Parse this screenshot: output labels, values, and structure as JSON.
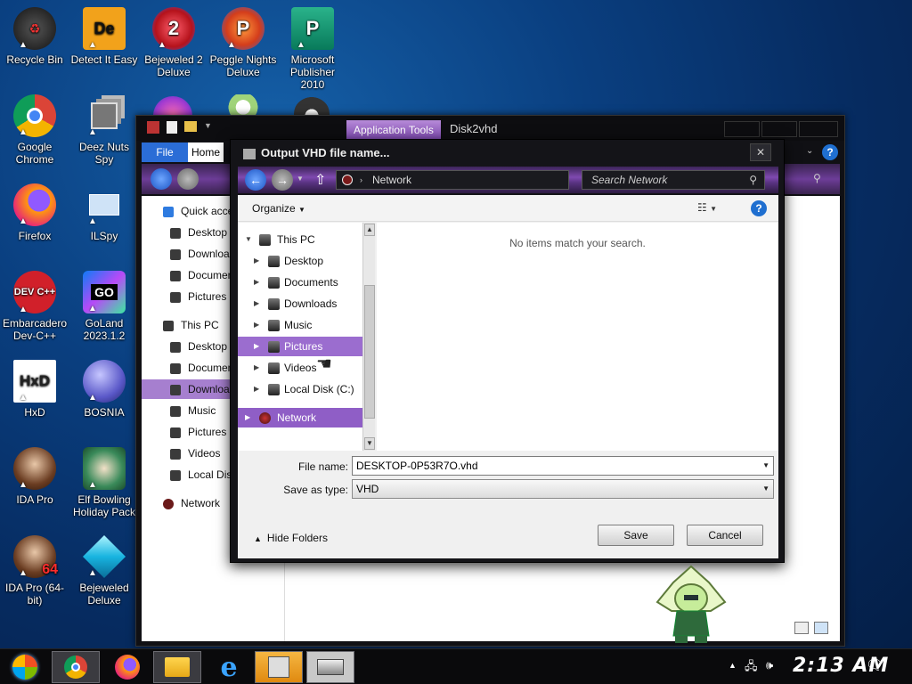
{
  "desktop": {
    "icons": [
      {
        "label": "Recycle Bin"
      },
      {
        "label": "Detect It Easy"
      },
      {
        "label": "Bejeweled 2 Deluxe"
      },
      {
        "label": "Peggle Nights Deluxe"
      },
      {
        "label": "Microsoft Publisher 2010"
      },
      {
        "label": "Google Chrome"
      },
      {
        "label": "Deez Nuts Spy"
      },
      {
        "label": "Firefox"
      },
      {
        "label": "ILSpy"
      },
      {
        "label": "Embarcadero Dev-C++"
      },
      {
        "label": "GoLand 2023.1.2"
      },
      {
        "label": "HxD"
      },
      {
        "label": "BOSNIA"
      },
      {
        "label": "IDA Pro"
      },
      {
        "label": "Elf Bowling Holiday Pack"
      },
      {
        "label": "IDA Pro (64-bit)"
      },
      {
        "label": "Bejeweled Deluxe"
      }
    ],
    "icon_glyphs": {
      "detect": "De",
      "devcpp": "DEV C++",
      "goland": "GO",
      "hxd": "HxD",
      "ida64": "64"
    }
  },
  "background_window": {
    "app_tools": "Application Tools",
    "title": "Disk2vhd",
    "ribbon": {
      "file": "File",
      "home": "Home"
    },
    "nav": [
      {
        "label": "Quick access"
      },
      {
        "label": "Desktop"
      },
      {
        "label": "Downloads"
      },
      {
        "label": "Documents"
      },
      {
        "label": "Pictures"
      },
      {
        "label": "This PC"
      },
      {
        "label": "Desktop"
      },
      {
        "label": "Documents"
      },
      {
        "label": "Downloads"
      },
      {
        "label": "Music"
      },
      {
        "label": "Pictures"
      },
      {
        "label": "Videos"
      },
      {
        "label": "Local Disk (C:)"
      },
      {
        "label": "Network"
      }
    ]
  },
  "dialog": {
    "title": "Output VHD file name...",
    "close_glyph": "✕",
    "address": "Network",
    "search_placeholder": "Search Network",
    "organize": "Organize",
    "empty_message": "No items match your search.",
    "tree": [
      {
        "label": "This PC"
      },
      {
        "label": "Desktop"
      },
      {
        "label": "Documents"
      },
      {
        "label": "Downloads"
      },
      {
        "label": "Music"
      },
      {
        "label": "Pictures"
      },
      {
        "label": "Videos"
      },
      {
        "label": "Local Disk (C:)"
      },
      {
        "label": "Network"
      }
    ],
    "file_name_label": "File name:",
    "file_name_value": "DESKTOP-0P53R7O.vhd",
    "save_type_label": "Save as type:",
    "save_type_value": "VHD",
    "hide_folders": "Hide Folders",
    "save_label": "Save",
    "cancel_label": "Cancel"
  },
  "taskbar": {
    "clock": "2:13 AM"
  },
  "colors": {
    "accent_purple": "#8f5ec6",
    "selection_purple": "#9b6dcf",
    "desktop_blue": "#0a3f80",
    "file_tab_blue": "#2b6dd6"
  }
}
